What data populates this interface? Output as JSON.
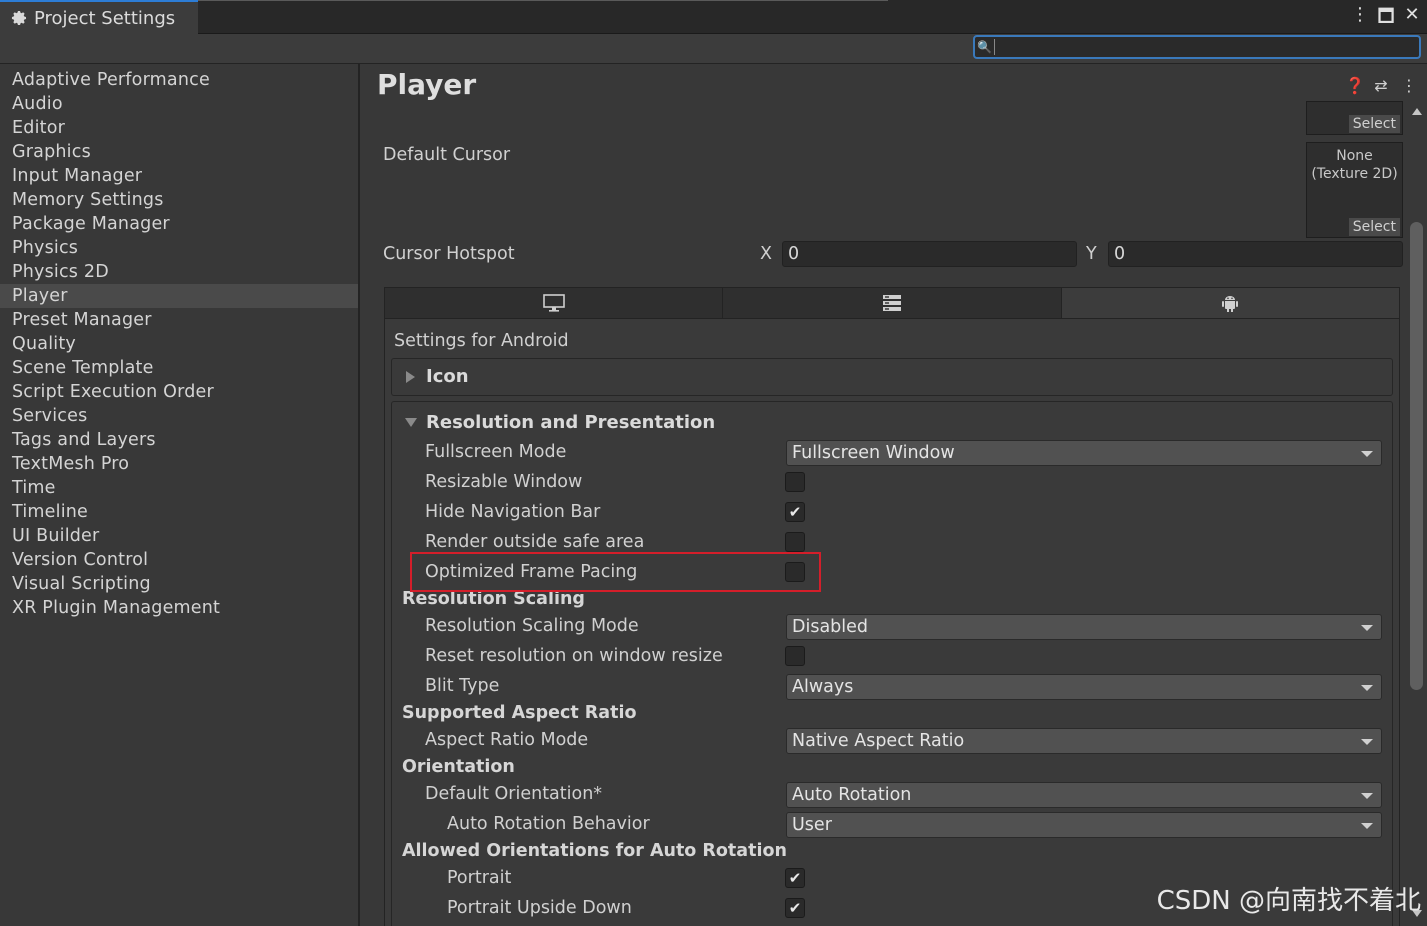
{
  "window": {
    "tab_title": "Project Settings"
  },
  "search": {
    "value": ""
  },
  "sidebar": {
    "items": [
      "Adaptive Performance",
      "Audio",
      "Editor",
      "Graphics",
      "Input Manager",
      "Memory Settings",
      "Package Manager",
      "Physics",
      "Physics 2D",
      "Player",
      "Preset Manager",
      "Quality",
      "Scene Template",
      "Script Execution Order",
      "Services",
      "Tags and Layers",
      "TextMesh Pro",
      "Time",
      "Timeline",
      "UI Builder",
      "Version Control",
      "Visual Scripting",
      "XR Plugin Management"
    ],
    "active": "Player"
  },
  "main": {
    "title": "Player",
    "top_texture": {
      "select_label": "Select"
    },
    "default_cursor": {
      "label": "Default Cursor",
      "texture_text_1": "None",
      "texture_text_2": "(Texture 2D)",
      "select_label": "Select"
    },
    "cursor_hotspot": {
      "label": "Cursor Hotspot",
      "x_label": "X",
      "x_value": "0",
      "y_label": "Y",
      "y_value": "0"
    },
    "platform_tabs": [
      "standalone",
      "server",
      "android"
    ],
    "active_platform": "android",
    "settings_for": "Settings for Android",
    "icon_section": "Icon",
    "resolution_section": "Resolution and Presentation",
    "fullscreen_mode": {
      "label": "Fullscreen Mode",
      "value": "Fullscreen Window"
    },
    "resizable_window": {
      "label": "Resizable Window",
      "checked": false
    },
    "hide_nav_bar": {
      "label": "Hide Navigation Bar",
      "checked": true
    },
    "render_outside_safe": {
      "label": "Render outside safe area",
      "checked": false
    },
    "optimized_frame_pacing": {
      "label": "Optimized Frame Pacing",
      "checked": false
    },
    "resolution_scaling": {
      "header": "Resolution Scaling",
      "mode_label": "Resolution Scaling Mode",
      "mode_value": "Disabled",
      "reset_label": "Reset resolution on window resize",
      "blit_label": "Blit Type",
      "blit_value": "Always"
    },
    "aspect_ratio": {
      "header": "Supported Aspect Ratio",
      "mode_label": "Aspect Ratio Mode",
      "mode_value": "Native Aspect Ratio"
    },
    "orientation": {
      "header": "Orientation",
      "default_label": "Default Orientation*",
      "default_value": "Auto Rotation",
      "auto_rotation_label": "Auto Rotation Behavior",
      "auto_rotation_value": "User"
    },
    "allowed_orientations": {
      "header": "Allowed Orientations for Auto Rotation",
      "portrait_label": "Portrait",
      "portrait_upside_label": "Portrait Upside Down"
    }
  },
  "watermark": "CSDN @向南找不着北",
  "colors": {
    "highlight": "#d41e2a",
    "accent": "#3a79bb"
  }
}
